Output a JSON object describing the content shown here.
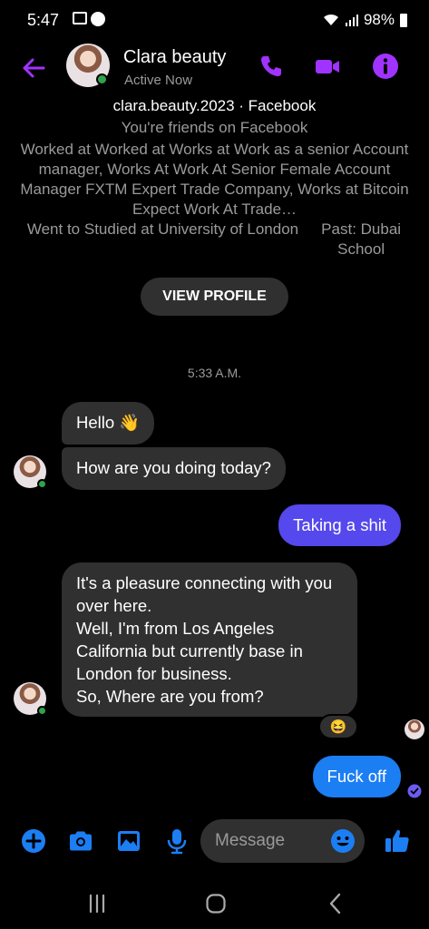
{
  "status_bar": {
    "time": "5:47",
    "battery": "98%"
  },
  "header": {
    "contact_name": "Clara beauty",
    "active_status": "Active Now"
  },
  "profile": {
    "handle": "clara.beauty.2023 · Facebook",
    "friends_line": "You're friends on Facebook",
    "work_line": "Worked at Worked at Works at Work as a senior Account manager, Works At Work At Senior Female Account Manager FXTM Expert Trade Company, Works at Bitcoin Expect Work At Trade…",
    "education_line": "Went to Studied at University of London",
    "past_line": "Past: Dubai School",
    "view_profile_label": "VIEW PROFILE"
  },
  "chat": {
    "timestamp": "5:33 A.M.",
    "messages": [
      {
        "from": "them",
        "text": "Hello 👋"
      },
      {
        "from": "them",
        "text": "How are you doing today?"
      },
      {
        "from": "me",
        "text": "Taking a shit"
      },
      {
        "from": "them",
        "text": "It's a pleasure connecting with you over here.\nWell, I'm from Los Angeles California but currently base in London for business.\nSo, Where are you from?"
      },
      {
        "from": "me",
        "text": "Fuck off"
      }
    ],
    "reaction": "😆"
  },
  "composer": {
    "placeholder": "Message"
  },
  "colors": {
    "accent_purple": "#a033ff",
    "outgoing_purple": "#5548ec",
    "outgoing_blue": "#1c7ef3",
    "composer_blue": "#1c7ef3",
    "incoming_gray": "#303030",
    "online_green": "#31a24c"
  },
  "icons": {
    "header": [
      "back-arrow-icon",
      "phone-icon",
      "video-camera-icon",
      "info-icon"
    ],
    "composer": [
      "plus-icon",
      "camera-icon",
      "image-icon",
      "microphone-icon",
      "emoji-icon",
      "thumbs-up-icon"
    ],
    "navbar": [
      "recent-apps-icon",
      "home-icon",
      "back-icon"
    ]
  }
}
